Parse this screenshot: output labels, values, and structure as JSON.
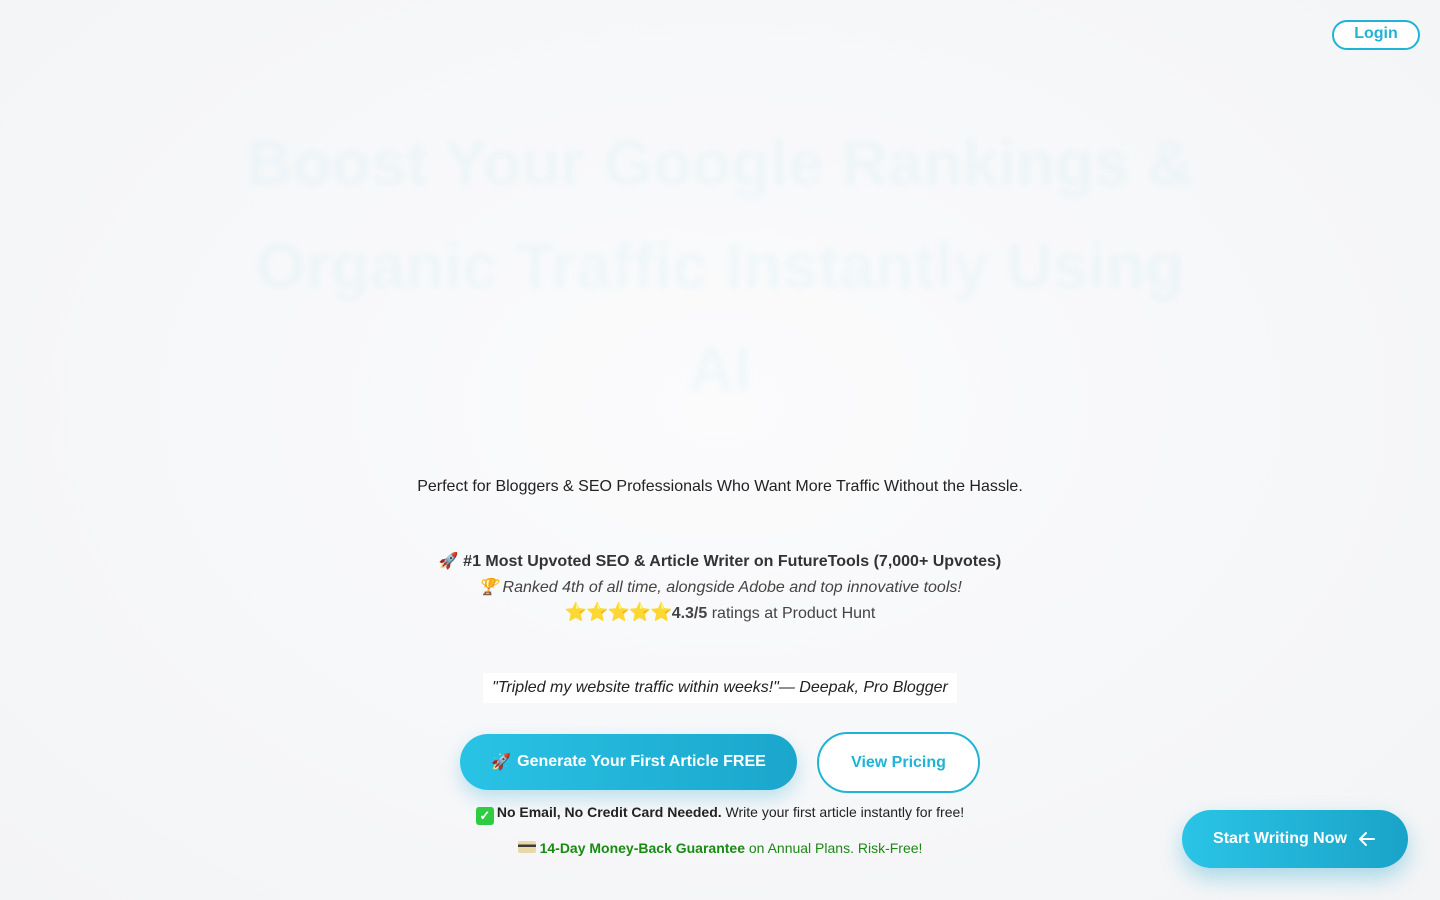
{
  "header": {
    "login_label": "Login"
  },
  "hero": {
    "headline": "Boost Your Google Rankings & Organic Traffic Instantly Using AI",
    "subtitle": "Perfect for Bloggers & SEO Professionals Who Want More Traffic Without the Hassle."
  },
  "social_proof": {
    "line1_icon": "🚀",
    "line1": "#1 Most Upvoted SEO & Article Writer on FutureTools (7,000+ Upvotes)",
    "line2_icon": "🏆",
    "line2": "Ranked 4th of all time, alongside Adobe and top innovative tools!",
    "stars": "⭐⭐⭐⭐⭐",
    "rating": "4.3/5",
    "rating_suffix": " ratings at Product Hunt"
  },
  "testimonial": {
    "quote": "\"Tripled my website traffic within weeks!\"",
    "author": "— Deepak, Pro Blogger"
  },
  "actions": {
    "primary_icon": "🚀",
    "primary_label": "Generate Your First Article FREE",
    "secondary_label": "View Pricing"
  },
  "notes": {
    "note1_bold": "No Email, No Credit Card Needed.",
    "note1_rest": " Write your first article instantly for free!",
    "note2_bold": "14-Day Money-Back Guarantee",
    "note2_rest": " on Annual Plans. Risk-Free!"
  },
  "floating_cta": {
    "label": "Start Writing Now"
  },
  "colors": {
    "accent": "#1fb4d6",
    "accent_dark": "#1ba6cc",
    "guarantee_green": "#1a8a12"
  },
  "icons": [
    "rocket-icon",
    "trophy-icon",
    "star-icon",
    "checkmark-icon",
    "credit-card-icon",
    "arrow-left-icon"
  ]
}
